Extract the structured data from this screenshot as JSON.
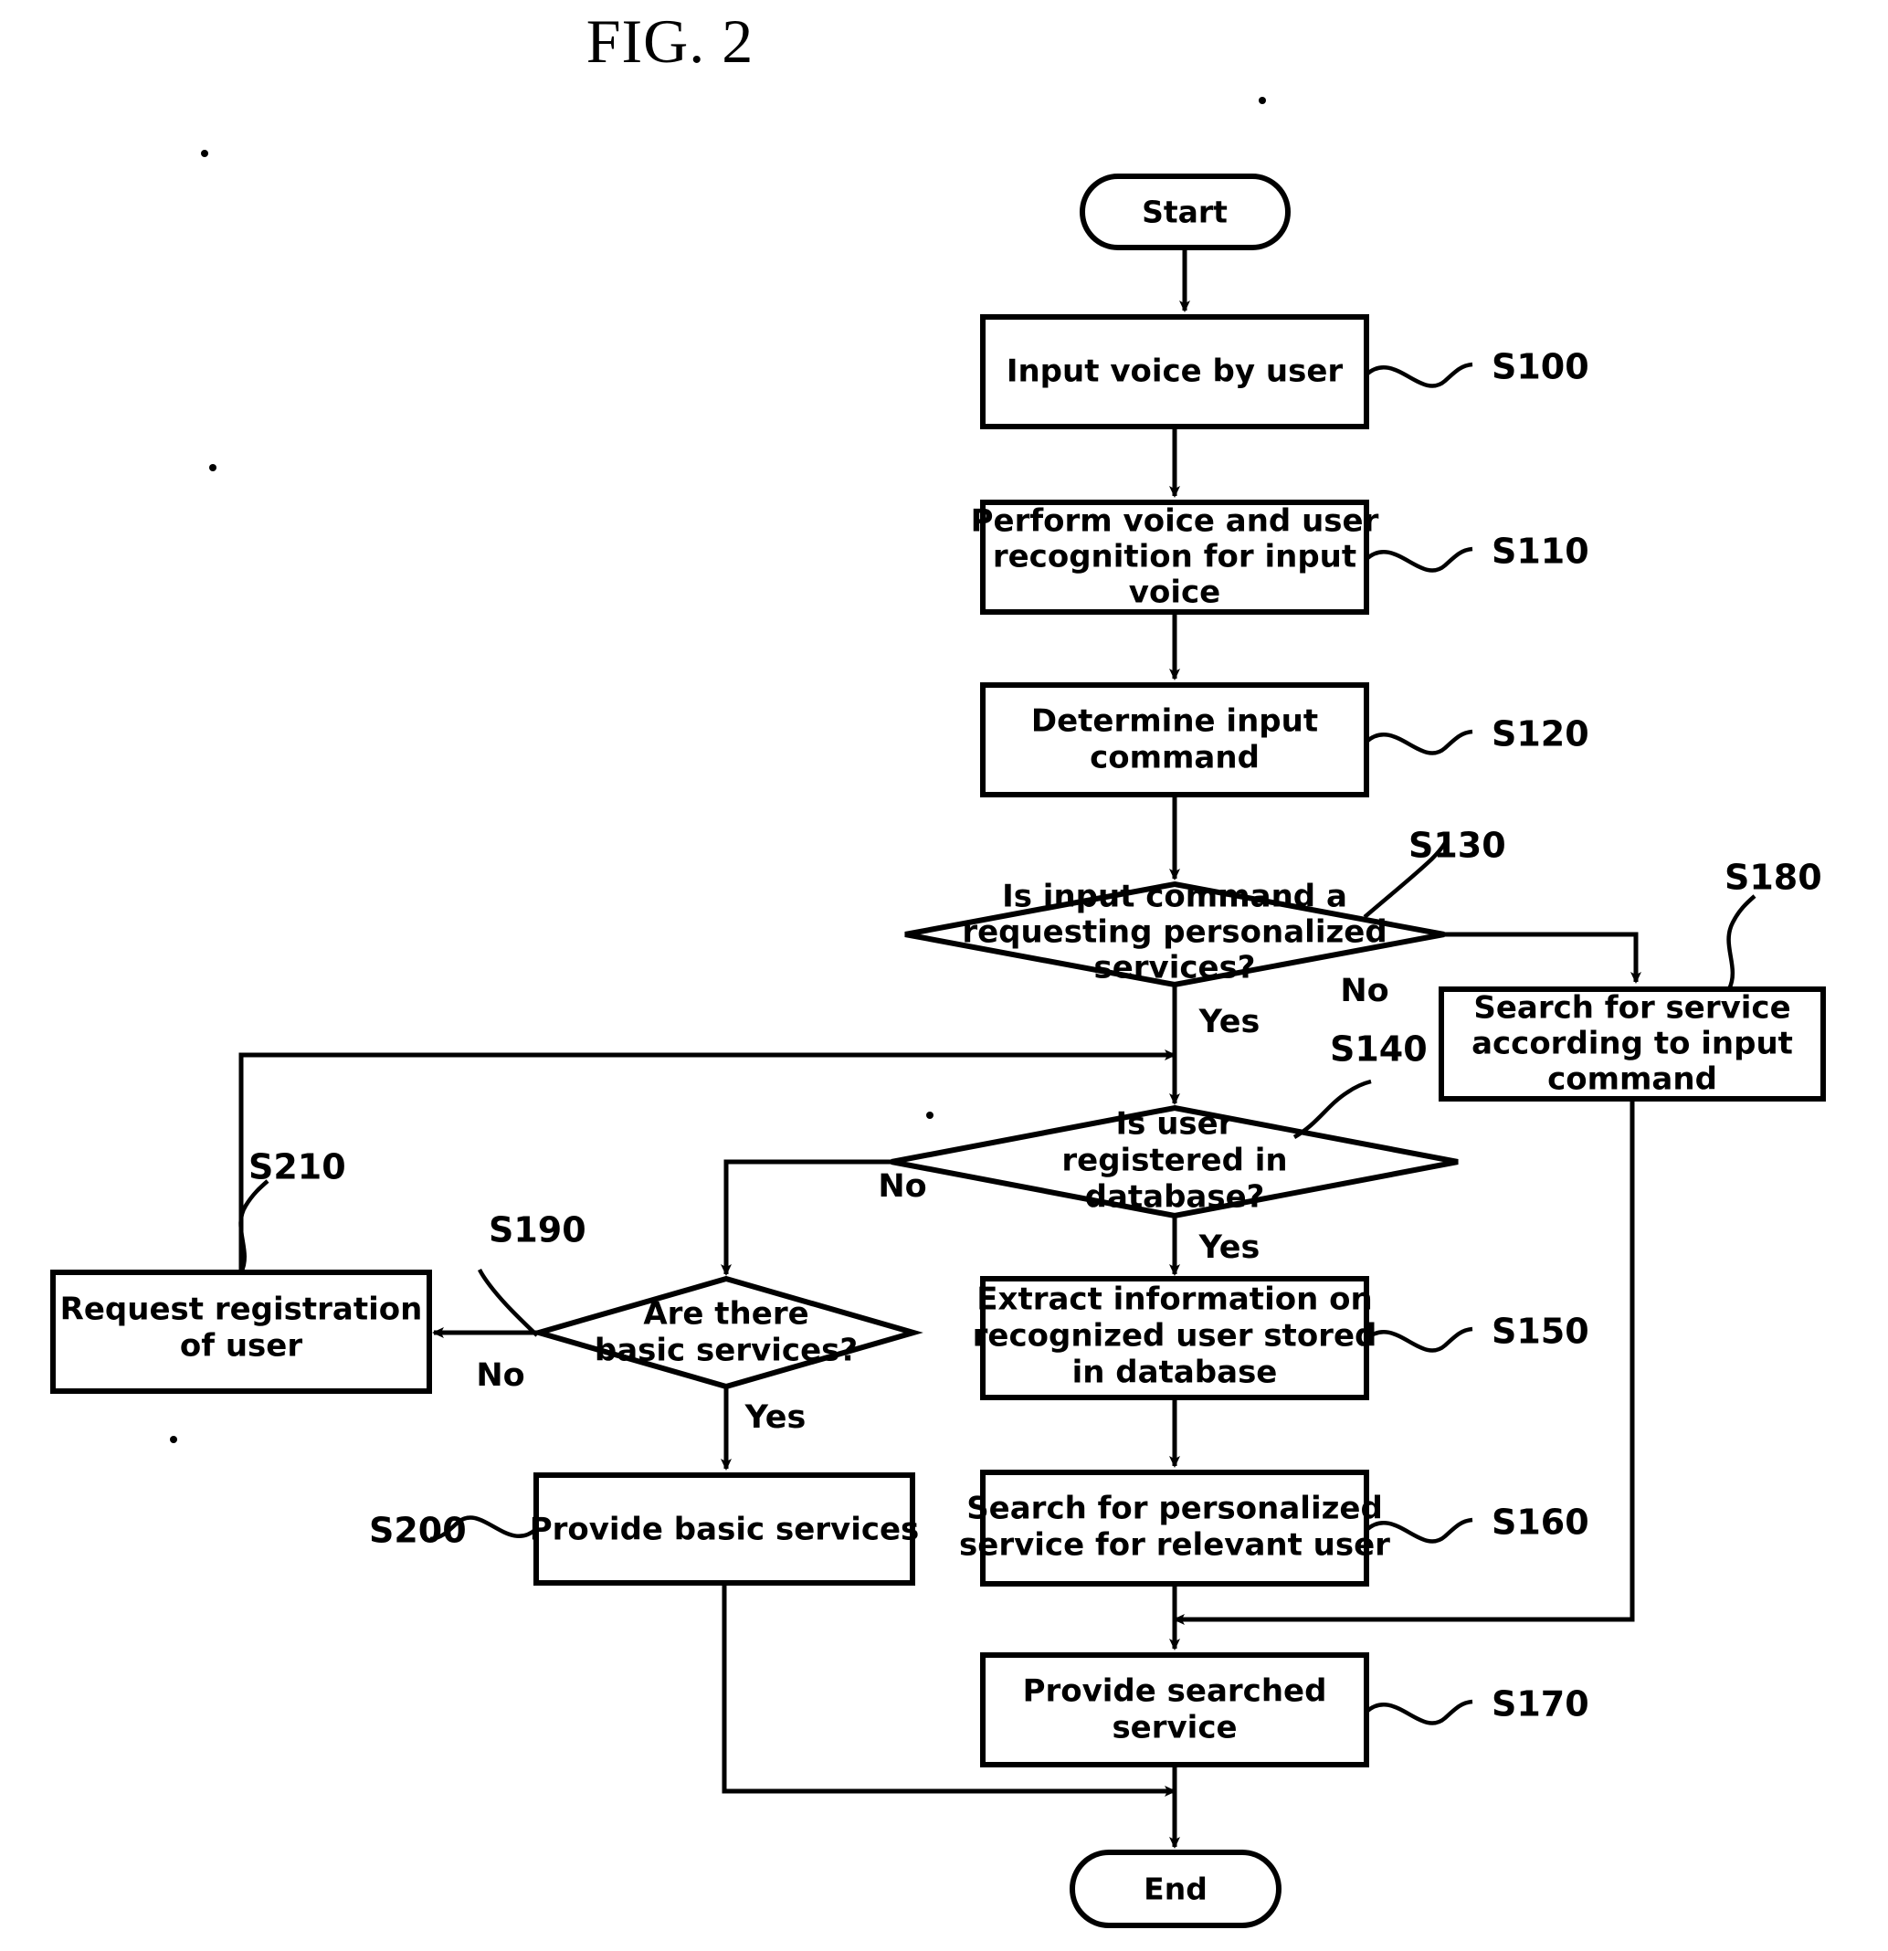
{
  "figure": {
    "title": "FIG. 2",
    "type": "flowchart"
  },
  "terminators": {
    "start": "Start",
    "end": "End"
  },
  "nodes": [
    {
      "id": "S100",
      "shape": "process",
      "label": "Input voice by user",
      "step": "S100"
    },
    {
      "id": "S110",
      "shape": "process",
      "line1": "Perform voice and user",
      "line2": "recognition for input",
      "line3": "voice",
      "step": "S110"
    },
    {
      "id": "S120",
      "shape": "process",
      "line1": "Determine input",
      "line2": "command",
      "step": "S120"
    },
    {
      "id": "S130",
      "shape": "decision",
      "line1": "Is input command a",
      "line2": "requesting personalized",
      "line3": "services?",
      "step": "S130"
    },
    {
      "id": "S180",
      "shape": "process",
      "line1": "Search for service",
      "line2": "according to input",
      "line3": "command",
      "step": "S180"
    },
    {
      "id": "S140",
      "shape": "decision",
      "line1": "Is user",
      "line2": "registered in",
      "line3": "database?",
      "step": "S140"
    },
    {
      "id": "S150",
      "shape": "process",
      "line1": "Extract information on",
      "line2": "recognized user stored",
      "line3": "in database",
      "step": "S150"
    },
    {
      "id": "S160",
      "shape": "process",
      "line1": "Search for personalized",
      "line2": "service for relevant user",
      "step": "S160"
    },
    {
      "id": "S170",
      "shape": "process",
      "line1": "Provide searched",
      "line2": "service",
      "step": "S170"
    },
    {
      "id": "S190",
      "shape": "decision",
      "line1": "Are there",
      "line2": "basic services?",
      "step": "S190"
    },
    {
      "id": "S200",
      "shape": "process",
      "label": "Provide basic services",
      "step": "S200"
    },
    {
      "id": "S210",
      "shape": "process",
      "line1": "Request registration",
      "line2": "of user",
      "step": "S210"
    }
  ],
  "branch_labels": {
    "s130_no": "No",
    "s130_yes": "Yes",
    "s140_no": "No",
    "s140_yes": "Yes",
    "s190_no": "No",
    "s190_yes": "Yes"
  },
  "step_labels": {
    "s100": "S100",
    "s110": "S110",
    "s120": "S120",
    "s130": "S130",
    "s140": "S140",
    "s150": "S150",
    "s160": "S160",
    "s170": "S170",
    "s180": "S180",
    "s190": "S190",
    "s200": "S200",
    "s210": "S210"
  },
  "colors": {
    "stroke": "#000000",
    "fill": "#ffffff",
    "background": "#ffffff"
  }
}
